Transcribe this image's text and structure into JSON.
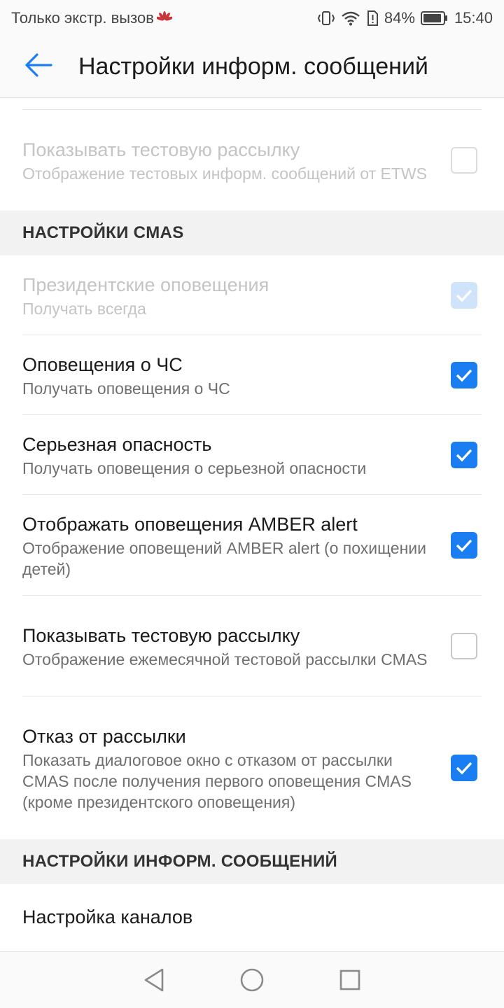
{
  "status_bar": {
    "carrier": "Только экстр. вызов",
    "battery": "84%",
    "time": "15:40"
  },
  "header": {
    "title": "Настройки информ. сообщений"
  },
  "etws_items": [
    {
      "title": "Показывать тестовую рассылку",
      "summary": "Отображение тестовых информ. сообщений от ETWS",
      "checked": false,
      "enabled": false
    }
  ],
  "cmas_section": {
    "header": "НАСТРОЙКИ CMAS",
    "items": [
      {
        "title": "Президентские оповещения",
        "summary": "Получать всегда",
        "checked": true,
        "enabled": false
      },
      {
        "title": "Оповещения о ЧС",
        "summary": "Получать оповещения о ЧС",
        "checked": true,
        "enabled": true
      },
      {
        "title": "Серьезная опасность",
        "summary": "Получать оповещения о серьезной опасности",
        "checked": true,
        "enabled": true
      },
      {
        "title": "Отображать оповещения AMBER alert",
        "summary": "Отображение оповещений AMBER alert (о похищении детей)",
        "checked": true,
        "enabled": true
      },
      {
        "title": "Показывать тестовую рассылку",
        "summary": "Отображение ежемесячной тестовой рассылки CMAS",
        "checked": false,
        "enabled": true
      },
      {
        "title": "Отказ от рассылки",
        "summary": "Показать диалоговое окно с отказом от рассылки CMAS после получения первого оповещения CMAS (кроме президентского оповещения)",
        "checked": true,
        "enabled": true
      }
    ]
  },
  "broadcast_section": {
    "header": "НАСТРОЙКИ ИНФОРМ. СООБЩЕНИЙ",
    "items": [
      {
        "title": "Настройка каналов"
      }
    ]
  },
  "colors": {
    "accent": "#1a7ef2",
    "disabled_text": "#c4c4c4"
  },
  "icons": {
    "back": "arrow-left-icon",
    "checkbox_check": "checkmark-icon",
    "nav_back": "triangle-back-icon",
    "nav_home": "circle-home-icon",
    "nav_recents": "square-recents-icon"
  }
}
